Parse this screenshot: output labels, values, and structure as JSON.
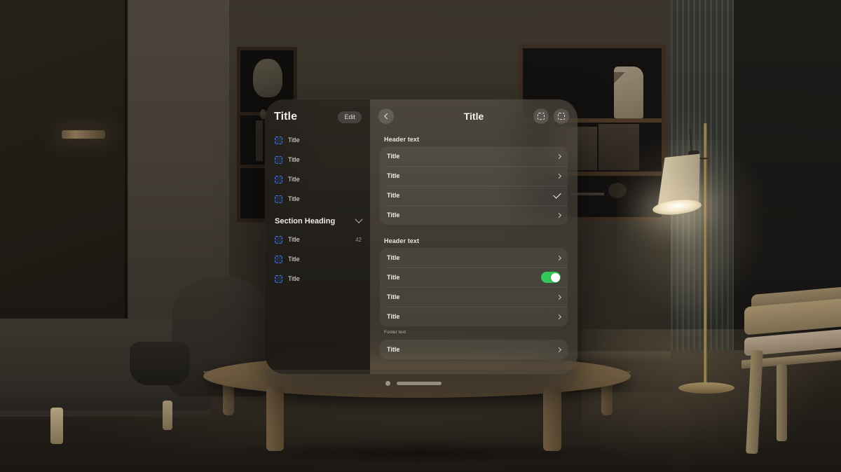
{
  "scene": {
    "description": "dark living room with floor lamp, shelves, sofa, coffee table"
  },
  "window": {
    "sidebar": {
      "title": "Title",
      "edit_label": "Edit",
      "top_items": [
        {
          "label": "Title",
          "icon": "placeholder-square-icon",
          "badge": ""
        },
        {
          "label": "Title",
          "icon": "placeholder-square-icon",
          "badge": ""
        },
        {
          "label": "Title",
          "icon": "placeholder-square-icon",
          "badge": ""
        },
        {
          "label": "Title",
          "icon": "placeholder-square-icon",
          "badge": ""
        }
      ],
      "section": {
        "heading": "Section Heading",
        "chevron": "chevron-down-icon",
        "items": [
          {
            "label": "Title",
            "icon": "placeholder-square-icon",
            "badge": "42"
          },
          {
            "label": "Title",
            "icon": "placeholder-square-icon",
            "badge": ""
          },
          {
            "label": "Title",
            "icon": "placeholder-square-icon",
            "badge": ""
          }
        ]
      }
    },
    "detail": {
      "back_icon": "chevron-left-icon",
      "title": "Title",
      "action_icons": [
        "placeholder-square-icon",
        "placeholder-square-icon"
      ],
      "groups": [
        {
          "header": "Header text",
          "rows": [
            {
              "label": "Title",
              "accessory": "chevron"
            },
            {
              "label": "Title",
              "accessory": "chevron"
            },
            {
              "label": "Title",
              "accessory": "checkmark"
            },
            {
              "label": "Title",
              "accessory": "chevron"
            }
          ],
          "footer": ""
        },
        {
          "header": "Header text",
          "rows": [
            {
              "label": "Title",
              "accessory": "chevron"
            },
            {
              "label": "Title",
              "accessory": "toggle-on"
            },
            {
              "label": "Title",
              "accessory": "chevron"
            },
            {
              "label": "Title",
              "accessory": "chevron"
            }
          ],
          "footer": "Footer text"
        },
        {
          "header": "",
          "rows": [
            {
              "label": "Title",
              "accessory": "chevron"
            }
          ],
          "footer": ""
        }
      ]
    },
    "bottom_bar": {
      "dot": "window-dot",
      "handle": "window-resize-handle"
    }
  },
  "colors": {
    "toggle_on": "#34C759",
    "placeholder_blue": "#4A78D8",
    "text_primary": "#F2EFEA",
    "text_secondary": "#B6AFA5"
  }
}
